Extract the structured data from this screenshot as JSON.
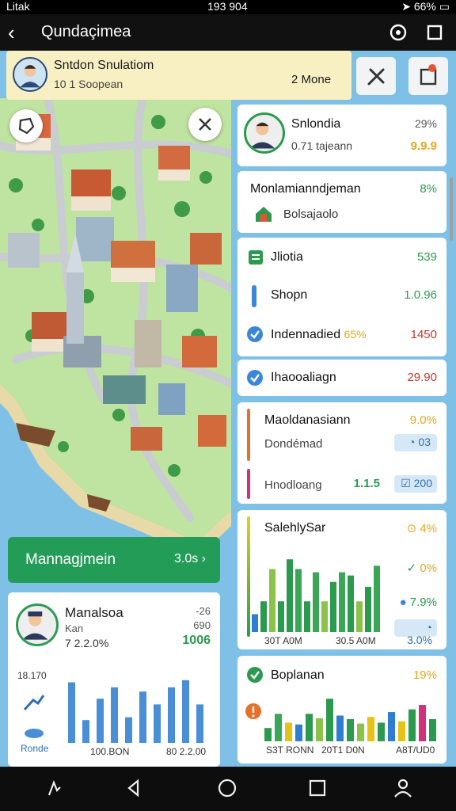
{
  "status": {
    "carrier": "Litak",
    "time": "193 904",
    "battery": "66%"
  },
  "app": {
    "title": "Qundaçimea"
  },
  "header": {
    "title": "Sntdon Snulatiom",
    "subtitle": "10 1 Soopean",
    "value": "2 Mone"
  },
  "manage": {
    "label": "Mannagjmein",
    "value": "3.0s"
  },
  "manager": {
    "name": "Manalsoa",
    "sub1": "Kan",
    "sub2": "7 2.2.0%",
    "r1": "-26",
    "r2": "690",
    "r3": "1006",
    "yvalue": "18.170",
    "label": "Ronde",
    "xlabels": [
      "100.BON",
      "80 2.2.00"
    ],
    "bars": [
      0.85,
      0.32,
      0.62,
      0.78,
      0.36,
      0.72,
      0.54,
      0.78,
      0.88,
      0.54
    ]
  },
  "panel1": {
    "name": "Snlondia",
    "sub": "0.71 tajeann",
    "pct": "29%",
    "value": "9.9.9"
  },
  "panel2": {
    "title": "Monlamianndjeman",
    "pct": "8%",
    "sub": "Bolsajaolo"
  },
  "panel3": {
    "rows": [
      {
        "label": "Jliotia",
        "value": "539",
        "color": "#2b9a4e"
      },
      {
        "label": "Shopn",
        "value": "1.0.96",
        "color": "#2b9a4e"
      },
      {
        "label": "Indennadied",
        "extra": "65%",
        "value": "1450",
        "color": "#c0392b"
      }
    ]
  },
  "panel4": {
    "label": "Ihaooaliagn",
    "value": "29.90"
  },
  "panel5": {
    "title": "Maoldanasiann",
    "pct": "9.0%",
    "row1": "Dondémad",
    "badge1": "03",
    "row2": "Hnodloang",
    "val2": "1.1.5",
    "badge2": "200"
  },
  "panel6": {
    "title": "SalehlySar",
    "pct1": "4%",
    "pct2": "0%",
    "pct3": "7.9%",
    "pct4": "3.0%",
    "xlabels": [
      "30T A0M",
      "30.5 A0M"
    ],
    "bars": [
      0.22,
      0.38,
      0.78,
      0.38,
      0.9,
      0.78,
      0.38,
      0.74,
      0.38,
      0.62,
      0.74,
      0.7,
      0.38,
      0.56,
      0.82
    ]
  },
  "panel7": {
    "title": "Boplanan",
    "pct": "19%",
    "xlabels": [
      "S3T RONN",
      "20T1 D0N",
      "A8T/UD0"
    ],
    "bars": [
      0.3,
      0.62,
      0.42,
      0.38,
      0.62,
      0.52,
      0.96,
      0.58,
      0.5,
      0.4,
      0.55,
      0.42,
      0.66,
      0.45,
      0.72,
      0.82,
      0.5
    ]
  }
}
